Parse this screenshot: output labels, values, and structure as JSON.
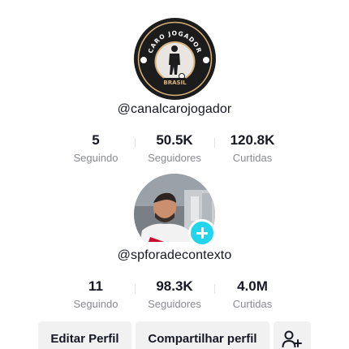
{
  "profile_1": {
    "logo": {
      "top_text": "CARO JOGADOR",
      "bottom_text": "BRASIL"
    },
    "username": "@canalcarojogador",
    "stats": [
      {
        "value": "5",
        "label": "Seguindo"
      },
      {
        "value": "50.5K",
        "label": "Seguidores"
      },
      {
        "value": "120.8K",
        "label": "Curtidas"
      }
    ]
  },
  "profile_2": {
    "username": "@spforadecontexto",
    "stats": [
      {
        "value": "11",
        "label": "Seguindo"
      },
      {
        "value": "98.3K",
        "label": "Seguidores"
      },
      {
        "value": "4.0M",
        "label": "Curtidas"
      }
    ]
  },
  "buttons": {
    "edit_profile": "Editar Perfil",
    "share_profile": "Compartilhar perfil",
    "add_friend_icon": "add-friend-icon"
  },
  "colors": {
    "badge": "#20d5ec",
    "muted_text": "#8a8b91",
    "button_bg": "#f1f1f2",
    "logo_ring": "#d9b27a"
  }
}
